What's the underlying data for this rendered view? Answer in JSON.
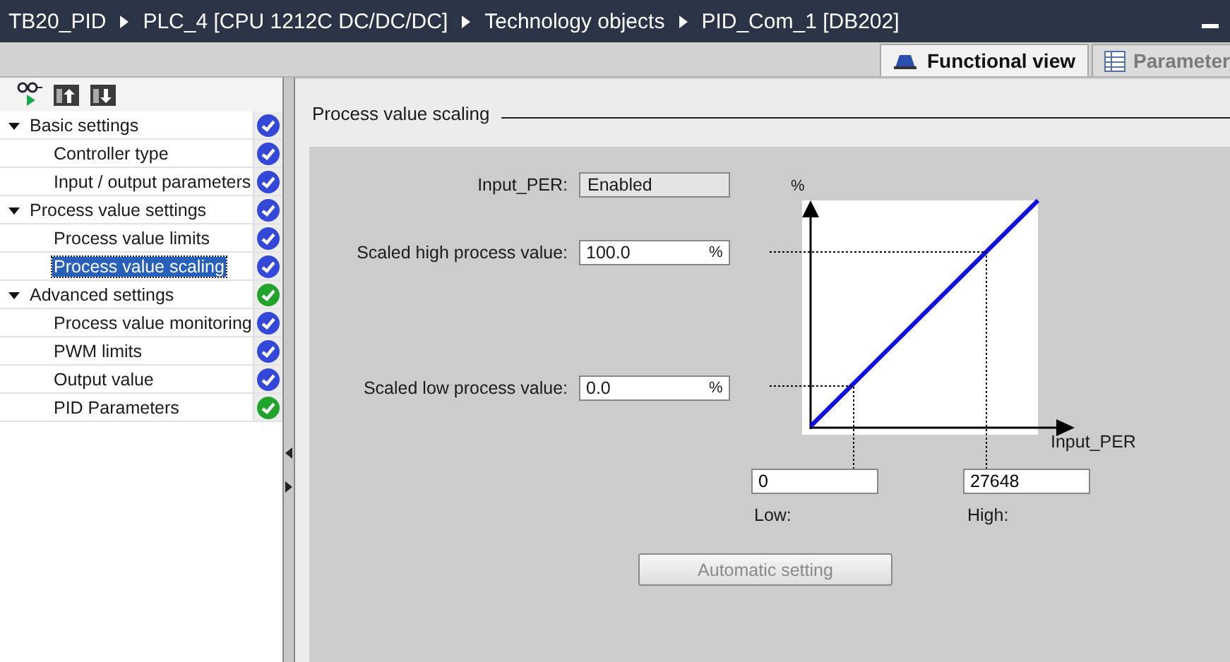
{
  "breadcrumb": [
    "TB20_PID",
    "PLC_4 [CPU 1212C DC/DC/DC]",
    "Technology objects",
    "PID_Com_1 [DB202]"
  ],
  "tabs": [
    {
      "label": "Functional view",
      "selected": true
    },
    {
      "label": "Parameter",
      "selected": false
    }
  ],
  "tree": [
    {
      "label": "Basic settings",
      "expanded": true,
      "selected": false,
      "color": "#3347d8",
      "children": [
        {
          "label": "Controller type",
          "selected": false,
          "color": "#3347d8"
        },
        {
          "label": "Input / output parameters",
          "selected": false,
          "color": "#3347d8"
        }
      ]
    },
    {
      "label": "Process value settings",
      "expanded": true,
      "selected": false,
      "color": "#3347d8",
      "children": [
        {
          "label": "Process value limits",
          "selected": false,
          "color": "#3347d8"
        },
        {
          "label": "Process value scaling",
          "selected": true,
          "color": "#3347d8"
        }
      ]
    },
    {
      "label": "Advanced settings",
      "expanded": true,
      "selected": false,
      "color": "#22a32a",
      "children": [
        {
          "label": "Process value monitoring",
          "selected": false,
          "color": "#3347d8"
        },
        {
          "label": "PWM limits",
          "selected": false,
          "color": "#3347d8"
        },
        {
          "label": "Output value",
          "selected": false,
          "color": "#3347d8"
        },
        {
          "label": "PID Parameters",
          "selected": false,
          "color": "#22a32a"
        }
      ]
    }
  ],
  "section": {
    "title": "Process value scaling"
  },
  "form": {
    "input_per": {
      "label": "Input_PER:",
      "value": "Enabled"
    },
    "high": {
      "label": "Scaled high process value:",
      "value": "100.0",
      "unit": "%"
    },
    "low": {
      "label": "Scaled low process value:",
      "value": "0.0",
      "unit": "%"
    }
  },
  "diagram": {
    "y_label": "%",
    "x_label": "Input_PER",
    "low": {
      "value": "0",
      "label": "Low:"
    },
    "high": {
      "value": "27648",
      "label": "High:"
    }
  },
  "button": {
    "label": "Automatic setting",
    "disabled": true
  }
}
